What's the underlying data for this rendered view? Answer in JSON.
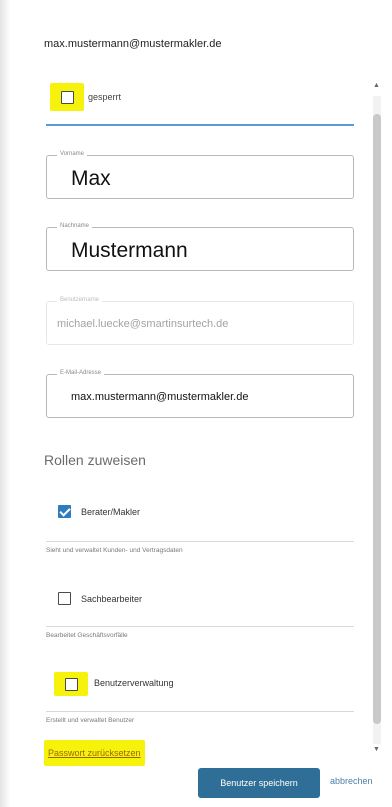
{
  "header": {
    "email": "max.mustermann@mustermakler.de"
  },
  "locked": {
    "label": "gesperrt",
    "checked": false
  },
  "fields": {
    "firstname": {
      "legend": "Vorname",
      "value": "Max"
    },
    "lastname": {
      "legend": "Nachname",
      "value": "Mustermann"
    },
    "username": {
      "legend": "Benutzername",
      "value": "michael.luecke@smartinsurtech.de"
    },
    "email": {
      "legend": "E-Mail-Adresse",
      "value": "max.mustermann@mustermakler.de"
    }
  },
  "roles": {
    "title": "Rollen zuweisen",
    "items": [
      {
        "label": "Berater/Makler",
        "description": "Sieht und verwaltet Kunden- und Vertragsdaten",
        "checked": true
      },
      {
        "label": "Sachbearbeiter",
        "description": "Bearbeitet Geschäftsvorfälle",
        "checked": false
      },
      {
        "label": "Benutzerverwaltung",
        "description": "Erstellt und verwaltet Benutzer",
        "checked": false
      }
    ]
  },
  "actions": {
    "reset_password": "Passwort zurücksetzen",
    "save": "Benutzer speichern",
    "cancel": "abbrechen"
  },
  "colors": {
    "highlight": "#f6f20b",
    "primary": "#2f6f97",
    "checkbox_checked": "#2f7bbf",
    "tab_underline": "#5b9bd5"
  },
  "icons": {
    "scroll_up": "scroll-up-arrow-icon",
    "scroll_down": "scroll-down-arrow-icon"
  }
}
